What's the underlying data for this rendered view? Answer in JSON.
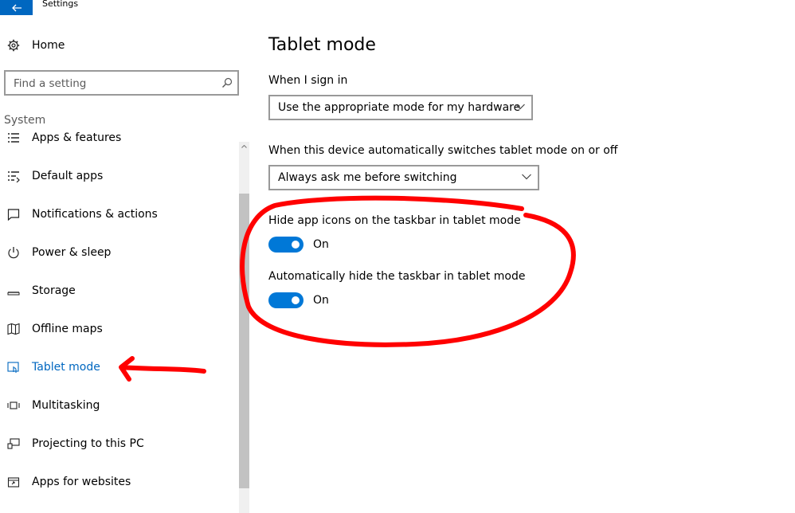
{
  "window": {
    "title": "Settings"
  },
  "nav": {
    "home_label": "Home",
    "search_placeholder": "Find a setting",
    "section_label": "System",
    "items": [
      {
        "label": "Apps & features",
        "icon": "apps-features-icon"
      },
      {
        "label": "Default apps",
        "icon": "default-apps-icon"
      },
      {
        "label": "Notifications & actions",
        "icon": "notifications-icon"
      },
      {
        "label": "Power & sleep",
        "icon": "power-icon"
      },
      {
        "label": "Storage",
        "icon": "storage-icon"
      },
      {
        "label": "Offline maps",
        "icon": "map-icon"
      },
      {
        "label": "Tablet mode",
        "icon": "tablet-mode-icon",
        "active": true
      },
      {
        "label": "Multitasking",
        "icon": "multitasking-icon"
      },
      {
        "label": "Projecting to this PC",
        "icon": "projecting-icon"
      },
      {
        "label": "Apps for websites",
        "icon": "apps-websites-icon"
      }
    ]
  },
  "main": {
    "title": "Tablet mode",
    "sign_in_label": "When I sign in",
    "sign_in_value": "Use the appropriate mode for my hardware",
    "switch_label": "When this device automatically switches tablet mode on or off",
    "switch_value": "Always ask me before switching",
    "hide_icons_label": "Hide app icons on the taskbar in tablet mode",
    "hide_icons_state": "On",
    "auto_hide_label": "Automatically hide the taskbar in tablet mode",
    "auto_hide_state": "On"
  },
  "colors": {
    "accent": "#0067c0",
    "toggle_on": "#0078d7",
    "annotation": "#ff0000"
  }
}
